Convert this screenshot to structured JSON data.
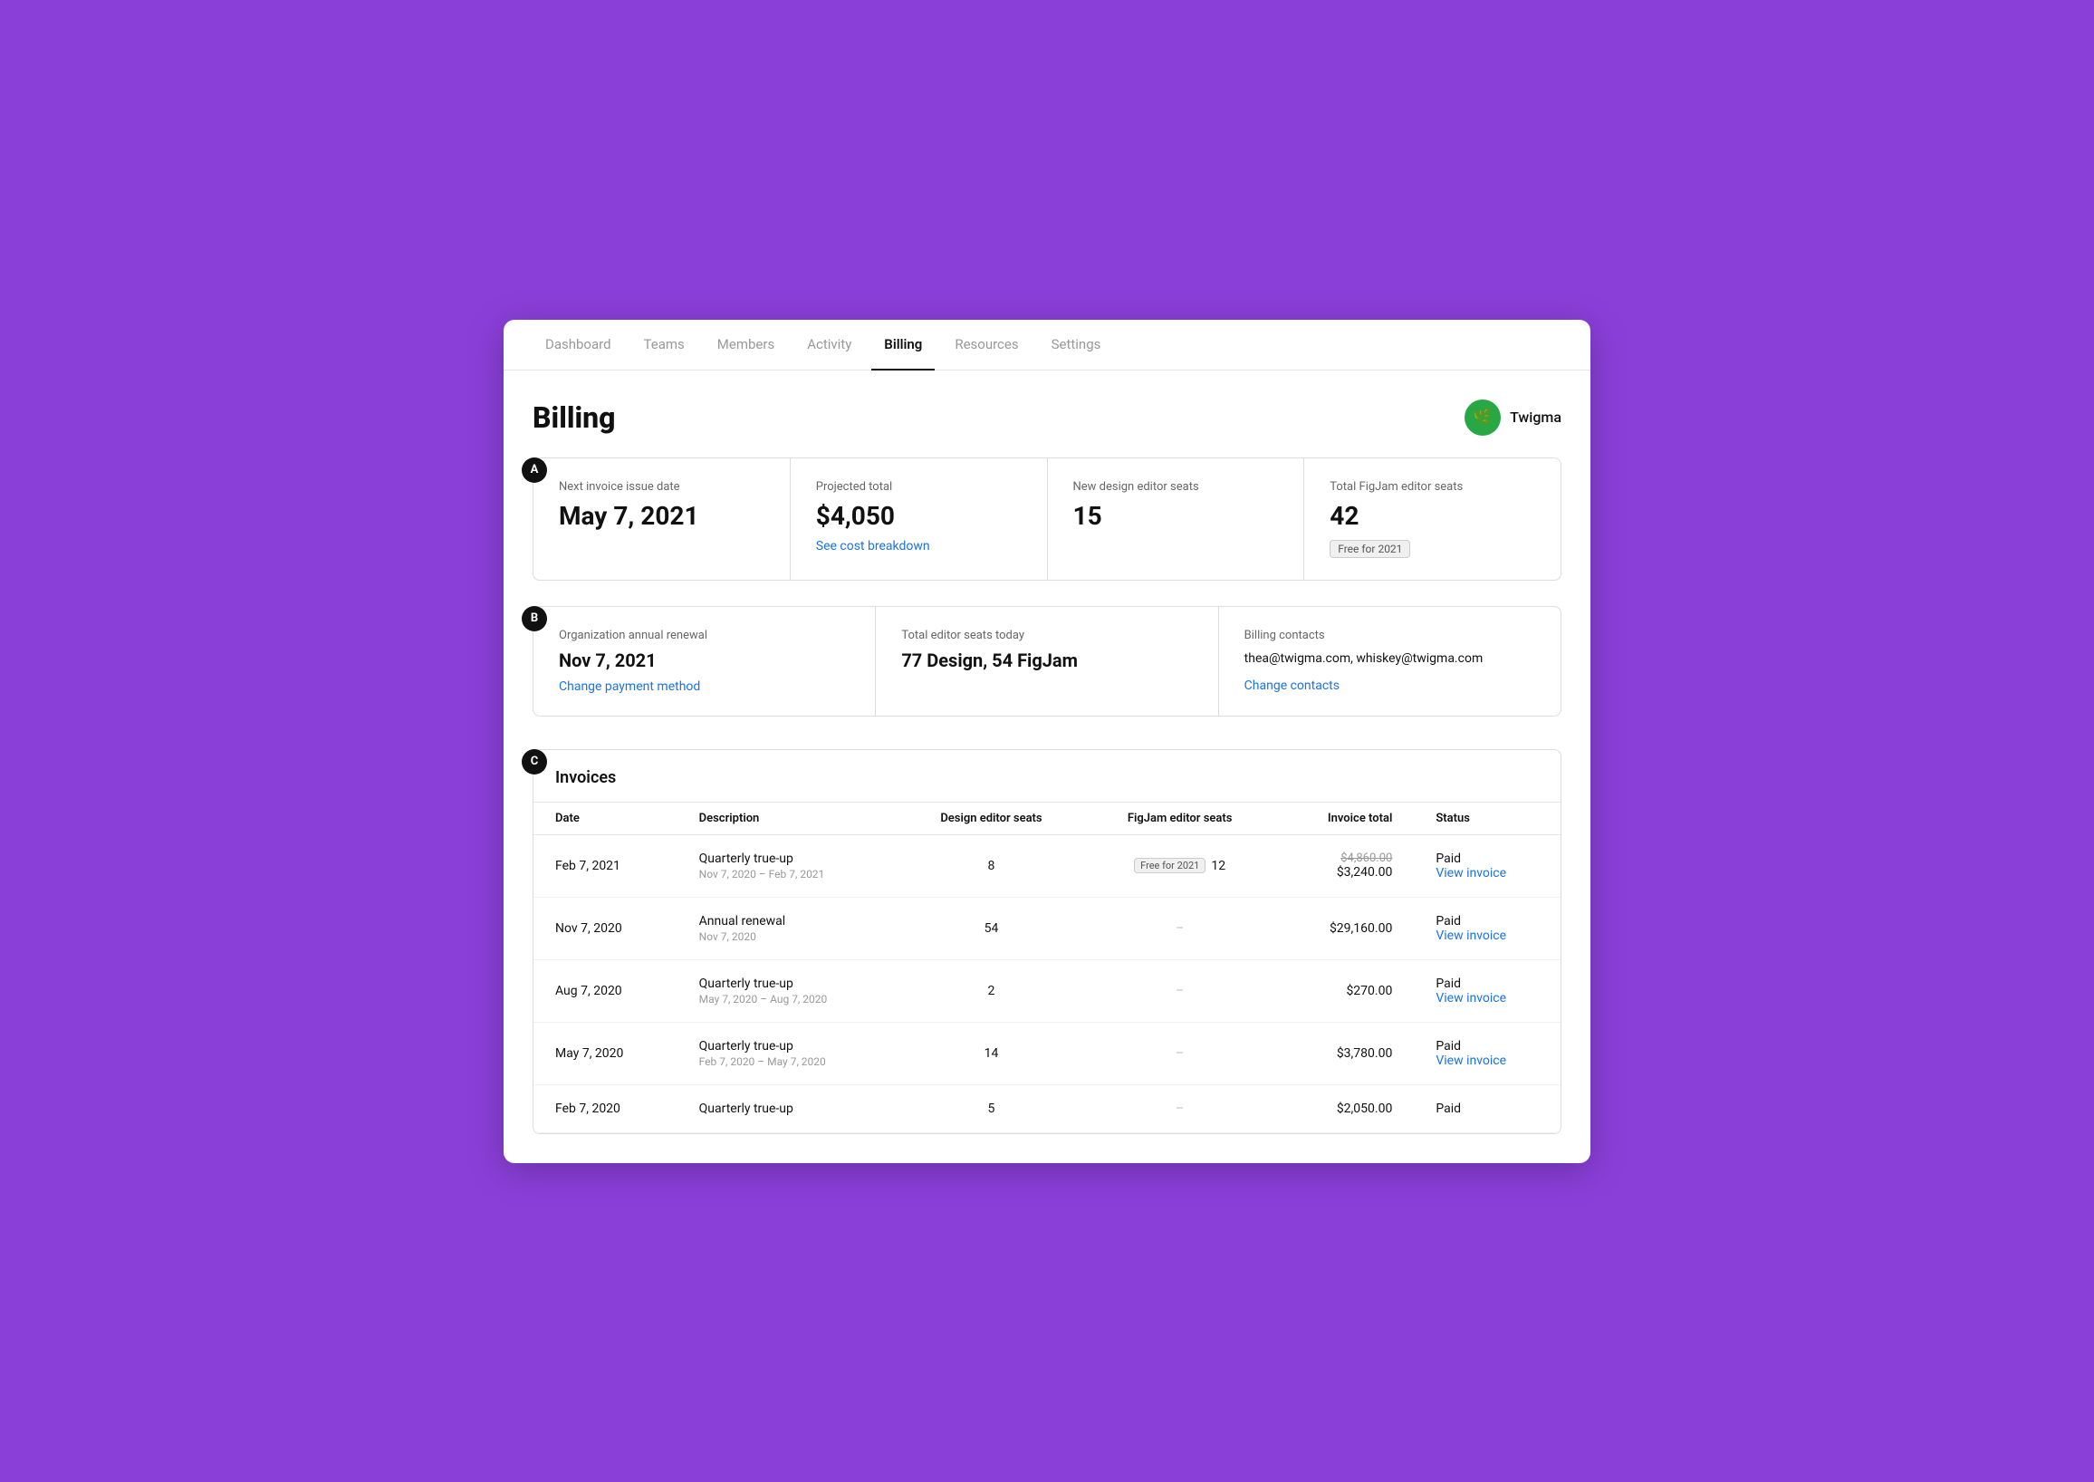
{
  "nav": {
    "items": [
      {
        "label": "Dashboard",
        "active": false
      },
      {
        "label": "Teams",
        "active": false
      },
      {
        "label": "Members",
        "active": false
      },
      {
        "label": "Activity",
        "active": false
      },
      {
        "label": "Billing",
        "active": true
      },
      {
        "label": "Resources",
        "active": false
      },
      {
        "label": "Settings",
        "active": false
      }
    ]
  },
  "header": {
    "title": "Billing",
    "org_name": "Twigma",
    "org_avatar_icon": "🌿"
  },
  "section_a": {
    "badge": "A",
    "cells": [
      {
        "label": "Next invoice issue date",
        "value": "May 7, 2021",
        "link": null
      },
      {
        "label": "Projected total",
        "value": "$4,050",
        "link": "See cost breakdown"
      },
      {
        "label": "New design editor seats",
        "value": "15",
        "link": null
      },
      {
        "label": "Total FigJam editor seats",
        "value": "42",
        "badge": "Free for 2021"
      }
    ]
  },
  "section_b": {
    "badge": "B",
    "cells": [
      {
        "label": "Organization annual renewal",
        "value": "Nov 7, 2021",
        "link": "Change payment method"
      },
      {
        "label": "Total editor seats today",
        "value": "77 Design, 54 FigJam",
        "link": null
      },
      {
        "label": "Billing contacts",
        "value": "thea@twigma.com, whiskey@twigma.com",
        "link": "Change contacts"
      }
    ]
  },
  "section_c": {
    "badge": "C",
    "title": "Invoices",
    "columns": [
      "Date",
      "Description",
      "Design editor seats",
      "FigJam editor seats",
      "Invoice total",
      "Status"
    ],
    "rows": [
      {
        "date": "Feb 7, 2021",
        "desc": "Quarterly true-up",
        "desc_sub": "Nov 7, 2020 – Feb 7, 2021",
        "design_seats": "8",
        "figjam_seats": "12",
        "figjam_badge": "Free for 2021",
        "invoice_total": "$3,240.00",
        "invoice_strikethrough": "$4,860.00",
        "status": "Paid",
        "view_invoice": "View invoice"
      },
      {
        "date": "Nov 7, 2020",
        "desc": "Annual renewal",
        "desc_sub": "Nov 7, 2020",
        "design_seats": "54",
        "figjam_seats": "–",
        "figjam_badge": null,
        "invoice_total": "$29,160.00",
        "invoice_strikethrough": null,
        "status": "Paid",
        "view_invoice": "View invoice"
      },
      {
        "date": "Aug 7, 2020",
        "desc": "Quarterly true-up",
        "desc_sub": "May 7, 2020 – Aug 7, 2020",
        "design_seats": "2",
        "figjam_seats": "–",
        "figjam_badge": null,
        "invoice_total": "$270.00",
        "invoice_strikethrough": null,
        "status": "Paid",
        "view_invoice": "View invoice"
      },
      {
        "date": "May 7, 2020",
        "desc": "Quarterly true-up",
        "desc_sub": "Feb 7, 2020 – May 7, 2020",
        "design_seats": "14",
        "figjam_seats": "–",
        "figjam_badge": null,
        "invoice_total": "$3,780.00",
        "invoice_strikethrough": null,
        "status": "Paid",
        "view_invoice": "View invoice"
      },
      {
        "date": "Feb 7, 2020",
        "desc": "Quarterly true-up",
        "desc_sub": "",
        "design_seats": "5",
        "figjam_seats": "–",
        "figjam_badge": null,
        "invoice_total": "$2,050.00",
        "invoice_strikethrough": null,
        "status": "Paid",
        "view_invoice": null
      }
    ]
  }
}
